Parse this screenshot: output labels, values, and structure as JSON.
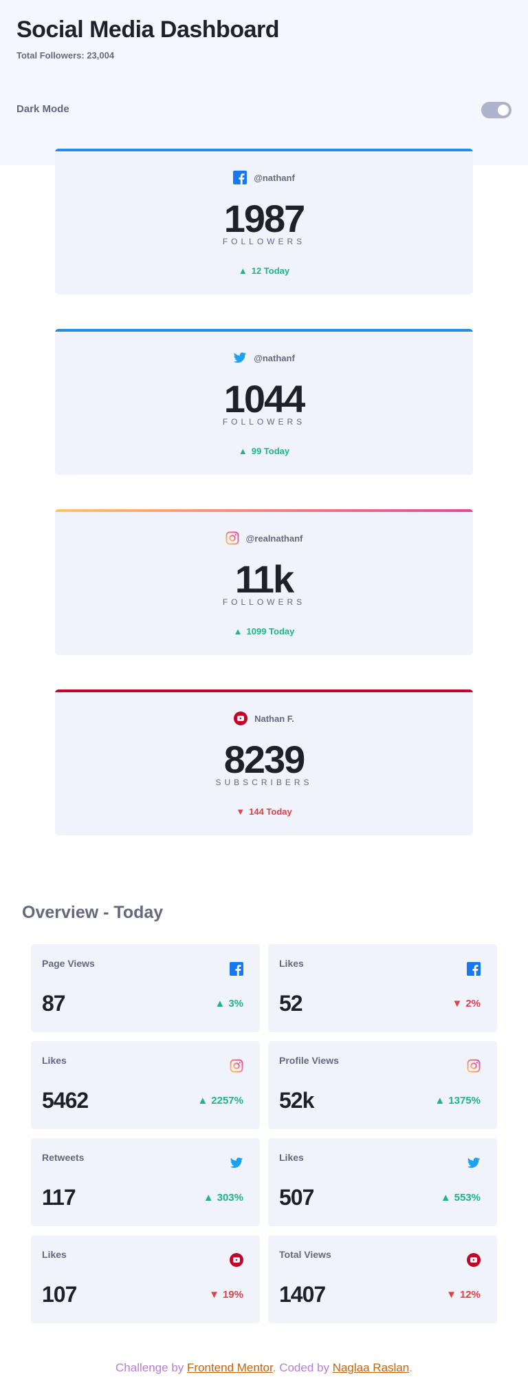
{
  "header": {
    "title": "Social Media Dashboard",
    "total_followers": "Total Followers: 23,004"
  },
  "dark_mode": {
    "label": "Dark Mode",
    "enabled": false
  },
  "colors": {
    "facebook": "#1877f2",
    "twitter": "#1da1f2",
    "instagram_start": "#fdc468",
    "instagram_end": "#df4996",
    "youtube": "#c4032a",
    "up": "#1db489",
    "down": "#dc414c"
  },
  "cards": [
    {
      "platform": "facebook",
      "icon": "facebook-icon",
      "handle": "@nathanf",
      "count": "1987",
      "label": "FOLLOWERS",
      "today": "12 Today",
      "trend": "up"
    },
    {
      "platform": "twitter",
      "icon": "twitter-icon",
      "handle": "@nathanf",
      "count": "1044",
      "label": "FOLLOWERS",
      "today": "99 Today",
      "trend": "up"
    },
    {
      "platform": "instagram",
      "icon": "instagram-icon",
      "handle": "@realnathanf",
      "count": "11k",
      "label": "FOLLOWERS",
      "today": "1099 Today",
      "trend": "up"
    },
    {
      "platform": "youtube",
      "icon": "youtube-icon",
      "handle": "Nathan F.",
      "count": "8239",
      "label": "SUBSCRIBERS",
      "today": "144 Today",
      "trend": "down"
    }
  ],
  "overview": {
    "title": "Overview - Today",
    "items": [
      {
        "metric": "Page Views",
        "icon": "facebook-icon",
        "value": "87",
        "percent": "3%",
        "trend": "up"
      },
      {
        "metric": "Likes",
        "icon": "facebook-icon",
        "value": "52",
        "percent": "2%",
        "trend": "down"
      },
      {
        "metric": "Likes",
        "icon": "instagram-icon",
        "value": "5462",
        "percent": "2257%",
        "trend": "up"
      },
      {
        "metric": "Profile Views",
        "icon": "instagram-icon",
        "value": "52k",
        "percent": "1375%",
        "trend": "up"
      },
      {
        "metric": "Retweets",
        "icon": "twitter-icon",
        "value": "117",
        "percent": "303%",
        "trend": "up"
      },
      {
        "metric": "Likes",
        "icon": "twitter-icon",
        "value": "507",
        "percent": "553%",
        "trend": "up"
      },
      {
        "metric": "Likes",
        "icon": "youtube-icon",
        "value": "107",
        "percent": "19%",
        "trend": "down"
      },
      {
        "metric": "Total Views",
        "icon": "youtube-icon",
        "value": "1407",
        "percent": "12%",
        "trend": "down"
      }
    ]
  },
  "footer": {
    "prefix": "Challenge by ",
    "link1": "Frontend Mentor",
    "middle": ". Coded by ",
    "link2": "Naglaa Raslan",
    "suffix": "."
  }
}
